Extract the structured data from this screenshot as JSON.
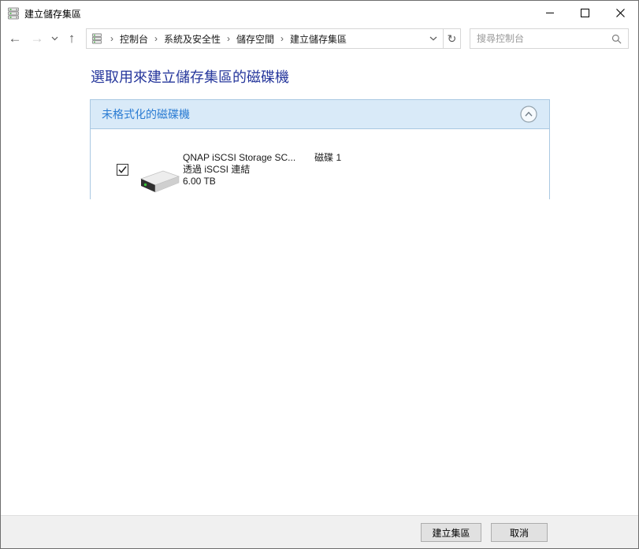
{
  "window": {
    "title": "建立儲存集區"
  },
  "navbar": {
    "breadcrumb": {
      "items": [
        "控制台",
        "系統及安全性",
        "儲存空間",
        "建立儲存集區"
      ]
    },
    "search": {
      "placeholder": "搜尋控制台"
    }
  },
  "icons": {
    "back": "←",
    "forward": "→",
    "up": "↑",
    "refresh": "↻",
    "crumb_sep": "›",
    "app_icon": "storage-stack",
    "search_icon": "magnifier",
    "collapse_icon": "chevron-up-circle",
    "drive_icon": "hard-drive-3d"
  },
  "main": {
    "heading": "選取用來建立儲存集區的磁碟機",
    "section": {
      "title": "未格式化的磁碟機",
      "drives": [
        {
          "name": "QNAP iSCSI Storage SC...",
          "disk_label": "磁碟 1",
          "connection": "透過 iSCSI 連結",
          "size": "6.00 TB",
          "checked": true
        }
      ]
    }
  },
  "footer": {
    "create_label": "建立集區",
    "cancel_label": "取消"
  },
  "colors": {
    "heading_text": "#26379c",
    "section_title_text": "#2b7cd3",
    "section_header_bg": "#d9eaf8",
    "panel_border": "#a9c8e2",
    "footer_bg": "#f0f0f0",
    "button_bg": "#e1e1e1",
    "button_border": "#adadad",
    "drive_led_green": "#35c735"
  }
}
